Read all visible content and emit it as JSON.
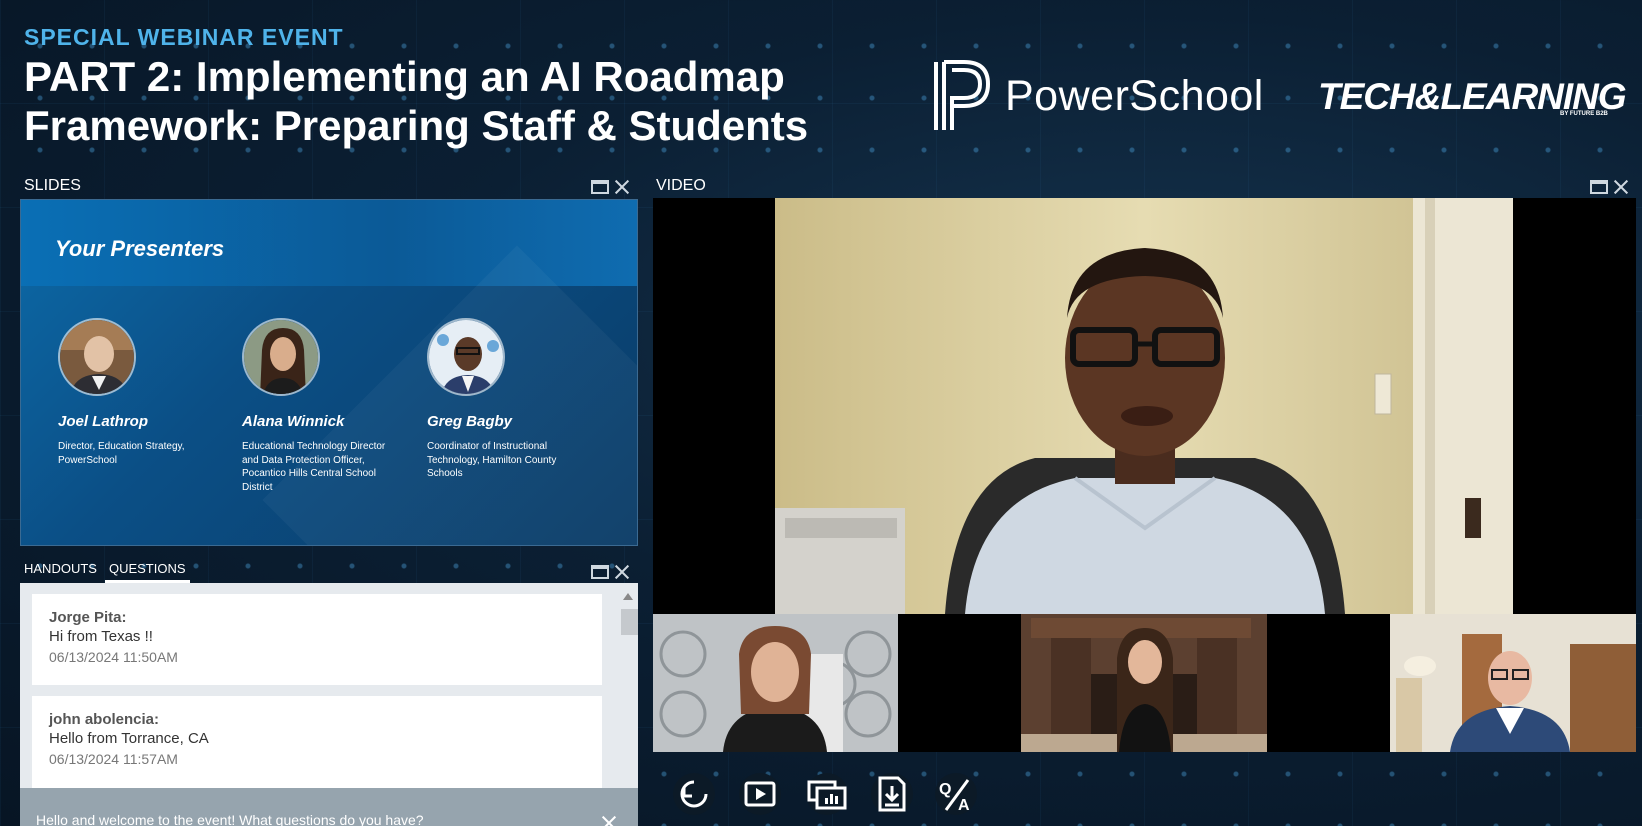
{
  "header": {
    "eyebrow": "SPECIAL WEBINAR EVENT",
    "title_line1": "PART 2: Implementing an AI Roadmap",
    "title_line2": "Framework: Preparing Staff & Students",
    "sponsor1": "PowerSchool",
    "sponsor2": "TECH&LEARNING",
    "sponsor2_sub": "BY FUTURE B2B"
  },
  "slides_panel": {
    "label": "SLIDES",
    "slide_title": "Your Presenters",
    "presenters": [
      {
        "name": "Joel Lathrop",
        "role": "Director, Education Strategy, PowerSchool"
      },
      {
        "name": "Alana Winnick",
        "role": "Educational Technology Director and Data Protection Officer, Pocantico Hills Central School District"
      },
      {
        "name": "Greg Bagby",
        "role": "Coordinator of Instructional Technology, Hamilton County Schools"
      }
    ]
  },
  "video_panel": {
    "label": "VIDEO"
  },
  "tabs": [
    {
      "label": "HANDOUTS",
      "active": false
    },
    {
      "label": "QUESTIONS",
      "active": true
    }
  ],
  "questions": [
    {
      "author": "Jorge Pita:",
      "text": "Hi from Texas !!",
      "time": "06/13/2024 11:50AM"
    },
    {
      "author": "john abolencia:",
      "text": "Hello from Torrance, CA",
      "time": "06/13/2024 11:57AM"
    }
  ],
  "welcome_message": "Hello and welcome to the event! What questions do you have?",
  "toolbar": [
    "replay-icon",
    "play-icon",
    "screens-icon",
    "download-icon",
    "qa-icon"
  ],
  "colors": {
    "accent": "#4fb3ea",
    "background": "#0b1f33",
    "slide_blue": "#0b5a97",
    "welcome_bar": "#96a4ae"
  }
}
